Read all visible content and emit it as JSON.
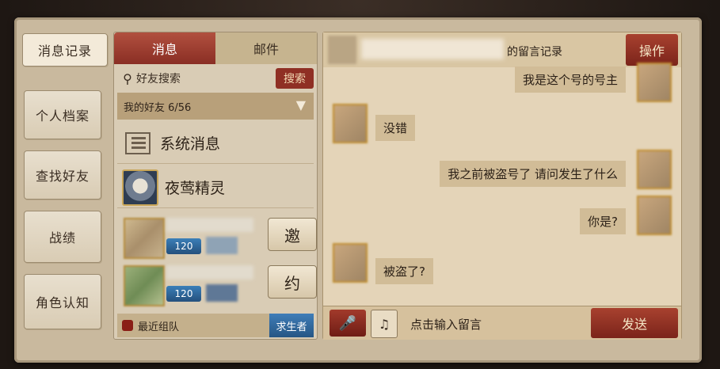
{
  "sidebar": {
    "tabs": [
      {
        "label": "消息记录"
      },
      {
        "label": "个人档案"
      },
      {
        "label": "查找好友"
      },
      {
        "label": "战绩"
      },
      {
        "label": "角色认知"
      }
    ]
  },
  "left_panel": {
    "tabs": [
      {
        "label": "消息"
      },
      {
        "label": "邮件"
      }
    ],
    "search": {
      "placeholder": "好友搜索",
      "button": "搜索"
    },
    "friend_group": {
      "label": "我的好友 6/56"
    },
    "system_item": {
      "label": "系统消息"
    },
    "nightingale_item": {
      "label": "夜莺精灵"
    },
    "friends": [
      {
        "level": "120",
        "action": "邀"
      },
      {
        "level": "120",
        "action": "约"
      }
    ],
    "recent_team": {
      "label": "最近组队"
    },
    "role_button": {
      "label": "求生者"
    }
  },
  "chat": {
    "header_title": "的留言记录",
    "operate_button": "操作",
    "messages": [
      {
        "side": "right",
        "text": "我是这个号的号主"
      },
      {
        "side": "left",
        "text": "没错"
      },
      {
        "side": "right",
        "text": "我之前被盗号了 请问发生了什么"
      },
      {
        "side": "right",
        "text": "你是?"
      },
      {
        "side": "left",
        "text": "被盗了?"
      }
    ],
    "input_placeholder": "点击输入留言",
    "send_button": "发送"
  }
}
